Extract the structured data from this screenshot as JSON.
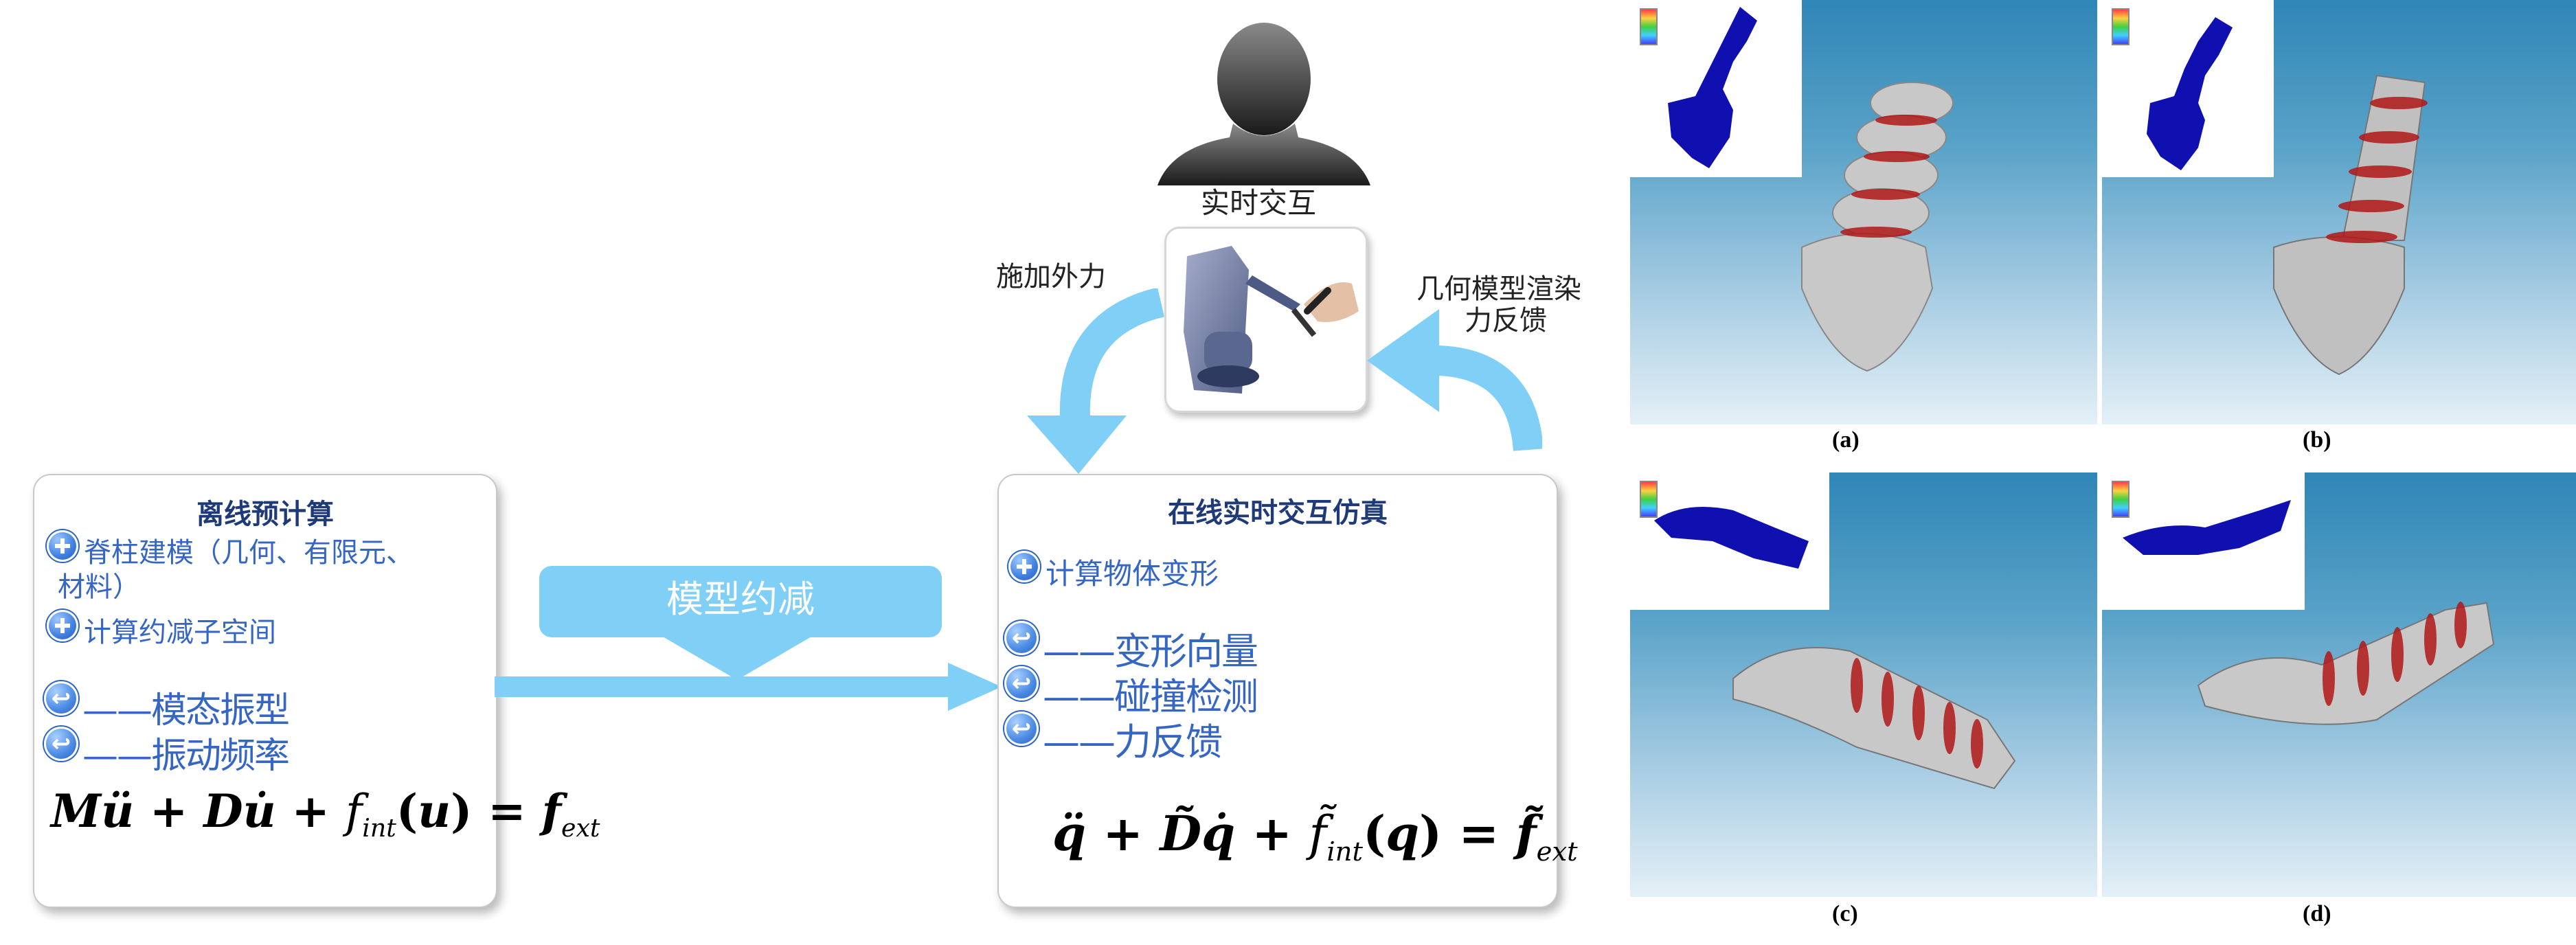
{
  "user": {
    "label": "实时交互"
  },
  "left_label": "施加外力",
  "right_label_line1": "几何模型渲染",
  "right_label_line2": "力反馈",
  "offline": {
    "title": "离线预计算",
    "items": [
      "脊柱建模（几何、有限元、",
      "材料）",
      "计算约减子空间"
    ],
    "outputs": [
      "——模态振型",
      "——振动频率"
    ],
    "formula": {
      "part1": "M",
      "part2": "ü",
      "part3": " + ",
      "part4": "D",
      "part5": "u̇",
      "part6": " + ",
      "part7": "f",
      "part7_sub": "int",
      "part8": "(",
      "part9": "u",
      "part10": ")",
      "part11": " = ",
      "part12": "f",
      "part12_sub": "ext"
    }
  },
  "reduction": {
    "label": "模型约减"
  },
  "online": {
    "title": "在线实时交互仿真",
    "items": [
      "计算物体变形"
    ],
    "outputs": [
      "——变形向量",
      "——碰撞检测",
      "——力反馈"
    ],
    "formula": {
      "part1": "q̈",
      "part2": " + ",
      "part3": "D̃",
      "part4": "q̇",
      "part5": " + ",
      "part6": "f̃",
      "part6_sub": "int",
      "part7": "(",
      "part8": "q",
      "part9": ")",
      "part10": " = ",
      "part11": "f̃",
      "part11_sub": "ext"
    }
  },
  "panels": {
    "a": "(a)",
    "b": "(b)",
    "c": "(c)",
    "d": "(d)"
  },
  "colors": {
    "arrow_blue": "#7fcff6",
    "title_blue": "#1f3a78",
    "item_blue": "#3566c4",
    "mesh_blue": "#1010b0",
    "vertebra_gray": "#c8c8c8",
    "disc_red": "#b01818"
  }
}
